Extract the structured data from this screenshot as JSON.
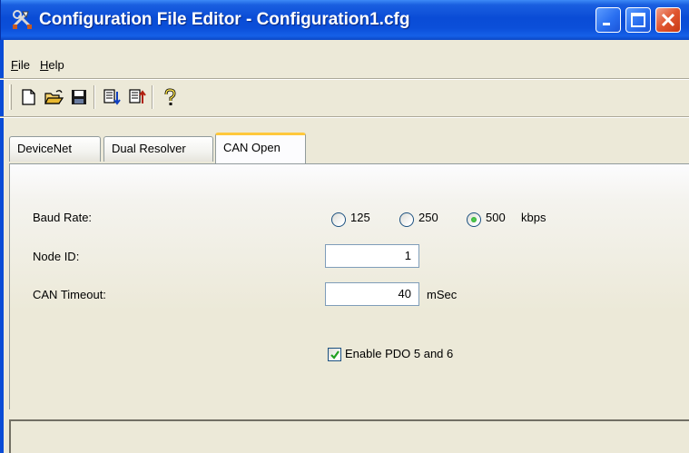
{
  "window": {
    "title": "Configuration File Editor - Configuration1.cfg",
    "icon": "tools-icon"
  },
  "menu": {
    "items": [
      {
        "label": "File",
        "accel": "F",
        "rest": "ile"
      },
      {
        "label": "Help",
        "accel": "H",
        "rest": "elp"
      }
    ]
  },
  "toolbar": {
    "buttons": [
      "new-file-icon",
      "open-folder-icon",
      "save-icon",
      "import-icon",
      "export-icon",
      "help-icon"
    ]
  },
  "tabs": [
    {
      "label": "DeviceNet",
      "active": false
    },
    {
      "label": "Dual Resolver",
      "active": false
    },
    {
      "label": "CAN Open",
      "active": true
    }
  ],
  "form": {
    "baud_rate": {
      "label": "Baud Rate:",
      "options": [
        "125",
        "250",
        "500"
      ],
      "selected": "500",
      "unit": "kbps"
    },
    "node_id": {
      "label": "Node ID:",
      "value": "1"
    },
    "can_timeout": {
      "label": "CAN Timeout:",
      "value": "40",
      "unit": "mSec"
    },
    "enable_pdo": {
      "label": "Enable PDO 5 and 6",
      "checked": true
    }
  },
  "colors": {
    "titlebar": "#0a4cd6",
    "active_tab_accent": "#ffc83c",
    "window_bg": "#ece9d8"
  }
}
